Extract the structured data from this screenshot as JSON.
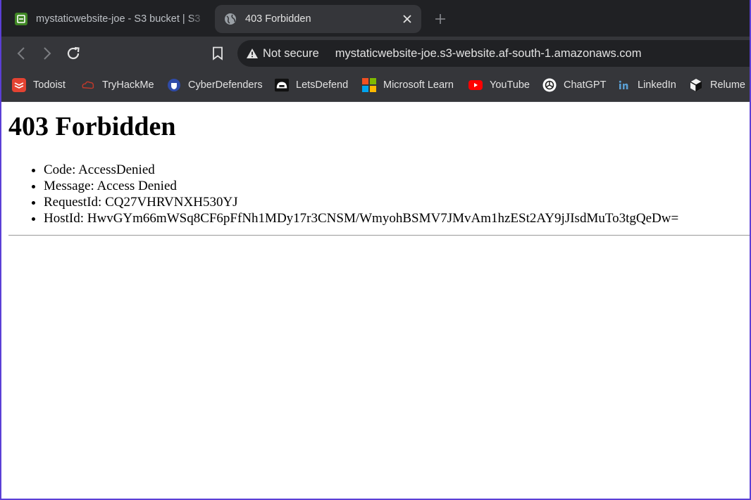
{
  "tabs": [
    {
      "title": "mystaticwebsite-joe - S3 bucket | S3",
      "favicon": "s3-bucket-icon",
      "active": false
    },
    {
      "title": "403 Forbidden",
      "favicon": "globe-icon",
      "active": true
    }
  ],
  "toolbar": {
    "security_label": "Not secure",
    "url": "mystaticwebsite-joe.s3-website.af-south-1.amazonaws.com"
  },
  "bookmarks": [
    {
      "label": "Todoist",
      "icon": "todoist-icon"
    },
    {
      "label": "TryHackMe",
      "icon": "tryhackme-icon"
    },
    {
      "label": "CyberDefenders",
      "icon": "cyberdefenders-icon"
    },
    {
      "label": "LetsDefend",
      "icon": "letsdefend-icon"
    },
    {
      "label": "Microsoft Learn",
      "icon": "microsoft-icon"
    },
    {
      "label": "YouTube",
      "icon": "youtube-icon"
    },
    {
      "label": "ChatGPT",
      "icon": "chatgpt-icon"
    },
    {
      "label": "LinkedIn",
      "icon": "linkedin-icon"
    },
    {
      "label": "Relume",
      "icon": "relume-icon"
    }
  ],
  "page": {
    "heading": "403 Forbidden",
    "details": [
      "Code: AccessDenied",
      "Message: Access Denied",
      "RequestId: CQ27VHRVNXH530YJ",
      "HostId: HwvGYm66mWSq8CF6pFfNh1MDy17r3CNSM/WmyohBSMV7JMvAm1hzESt2AY9jJIsdMuTo3tgQeDw="
    ]
  },
  "colors": {
    "tabstrip": "#202124",
    "toolbar": "#35363a",
    "text": "#e3e3e3",
    "frame": "#5b3fd6"
  }
}
